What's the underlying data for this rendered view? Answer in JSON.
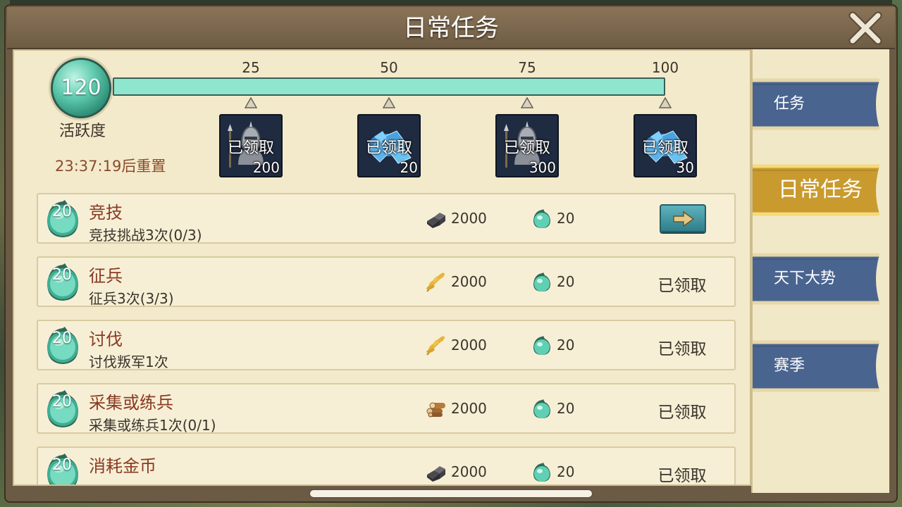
{
  "window": {
    "title": "日常任务",
    "close_icon": "close-icon"
  },
  "activity": {
    "value": "120",
    "label": "活跃度",
    "reset_text": "23:37:19后重置",
    "progress_fraction": 1.0
  },
  "milestones": [
    {
      "threshold": "25",
      "claimed_text": "已领取",
      "quantity": "200",
      "reward_icon": "soldier-helmet-icon"
    },
    {
      "threshold": "50",
      "claimed_text": "已领取",
      "quantity": "20",
      "reward_icon": "blue-gems-icon"
    },
    {
      "threshold": "75",
      "claimed_text": "已领取",
      "quantity": "300",
      "reward_icon": "soldier-helmet-icon"
    },
    {
      "threshold": "100",
      "claimed_text": "已领取",
      "quantity": "30",
      "reward_icon": "blue-gems-icon"
    }
  ],
  "tasks": [
    {
      "points": "20",
      "title": "竞技",
      "desc": "竞技挑战3次(0/3)",
      "resource_icon": "iron-ore-icon",
      "resource_amount": "2000",
      "activity_amount": "20",
      "status": "",
      "action": "go"
    },
    {
      "points": "20",
      "title": "征兵",
      "desc": "征兵3次(3/3)",
      "resource_icon": "wheat-icon",
      "resource_amount": "2000",
      "activity_amount": "20",
      "status": "已领取",
      "action": ""
    },
    {
      "points": "20",
      "title": "讨伐",
      "desc": "讨伐叛军1次",
      "resource_icon": "wheat-icon",
      "resource_amount": "2000",
      "activity_amount": "20",
      "status": "已领取",
      "action": ""
    },
    {
      "points": "20",
      "title": "采集或练兵",
      "desc": "采集或练兵1次(0/1)",
      "resource_icon": "wood-logs-icon",
      "resource_amount": "2000",
      "activity_amount": "20",
      "status": "已领取",
      "action": ""
    },
    {
      "points": "20",
      "title": "消耗金币",
      "desc": "",
      "resource_icon": "iron-ore-icon",
      "resource_amount": "2000",
      "activity_amount": "20",
      "status": "已领取",
      "action": ""
    }
  ],
  "sidebar": {
    "tabs": [
      {
        "label": "任务",
        "active": false
      },
      {
        "label": "日常任务",
        "active": true
      },
      {
        "label": "天下大势",
        "active": false
      },
      {
        "label": "赛季",
        "active": false
      }
    ]
  },
  "colors": {
    "panel": "#f3eacc",
    "progress_fill": "#8fe6cf",
    "task_title": "#8a3a22",
    "reset_text": "#8a4a2c",
    "tab_blue": "#4a6490",
    "tab_gold": "#c99a2e"
  }
}
